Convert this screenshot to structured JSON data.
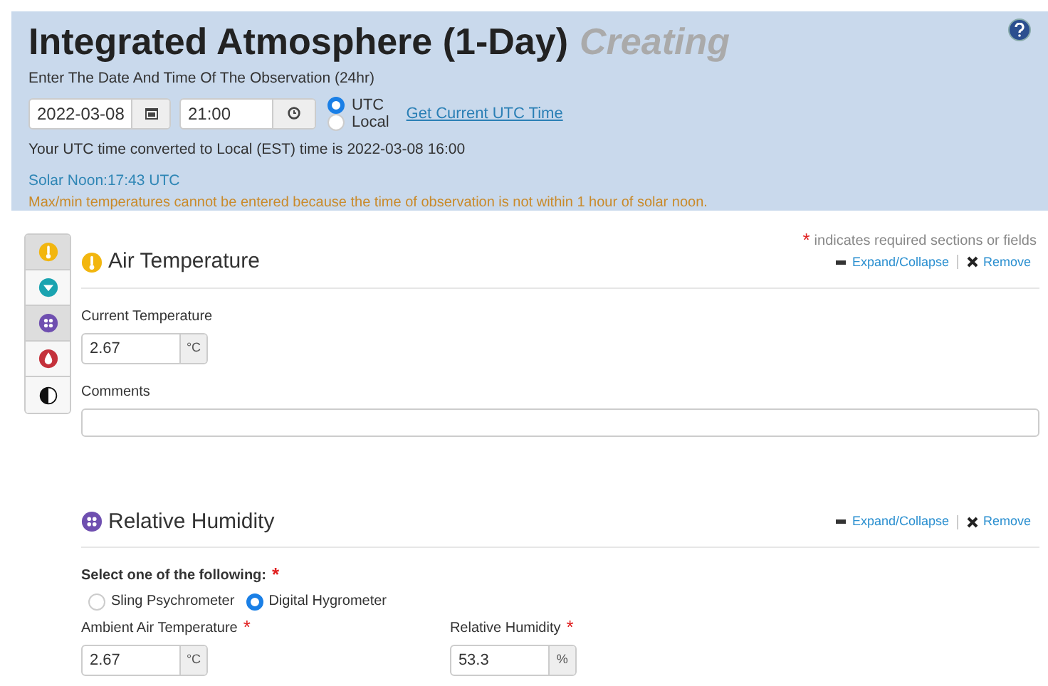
{
  "header": {
    "title": "Integrated Atmosphere (1-Day)",
    "status": "Creating",
    "prompt": "Enter The Date And Time Of The Observation (24hr)",
    "date": "2022-03-08",
    "time": "21:00",
    "timezones": [
      {
        "label": "UTC",
        "selected": true
      },
      {
        "label": "Local",
        "selected": false
      }
    ],
    "utc_link": "Get Current UTC Time",
    "converted": "Your UTC time converted to Local (EST) time is 2022-03-08 16:00",
    "solar_noon": "Solar Noon:17:43 UTC",
    "warning": "Max/min temperatures cannot be entered because the time of observation is not within 1 hour of solar noon."
  },
  "nav": [
    {
      "kind": "thermometer",
      "selected": true
    },
    {
      "kind": "funnel",
      "selected": false
    },
    {
      "kind": "drops",
      "selected": true
    },
    {
      "kind": "drop",
      "selected": false
    },
    {
      "kind": "contrast",
      "selected": false
    }
  ],
  "required_mark": "*",
  "required_note": "indicates required sections or fields",
  "sections": [
    {
      "kind": "thermometer",
      "title": "Air Temperature",
      "expand": "Expand/Collapse",
      "remove": "Remove",
      "fields": [
        {
          "kind": "unit_input",
          "label": "Current Temperature",
          "value": "2.67",
          "unit": "°C",
          "required": false
        },
        {
          "kind": "textarea",
          "label": "Comments",
          "required": false
        }
      ]
    },
    {
      "kind": "drops",
      "title": "Relative Humidity",
      "expand": "Expand/Collapse",
      "remove": "Remove",
      "fields": [
        {
          "kind": "radio_group",
          "label": "Select one of the following:",
          "required": true,
          "options": [
            {
              "label": "Sling Psychrometer",
              "selected": false
            },
            {
              "label": "Digital Hygrometer",
              "selected": true
            }
          ]
        },
        {
          "kind": "row",
          "items": [
            {
              "kind": "unit_input",
              "label": "Ambient Air Temperature",
              "value": "2.67",
              "unit": "°C",
              "required": true
            },
            {
              "kind": "unit_input",
              "label": "Relative Humidity",
              "value": "53.3",
              "unit": "%",
              "required": true
            }
          ]
        }
      ]
    }
  ]
}
